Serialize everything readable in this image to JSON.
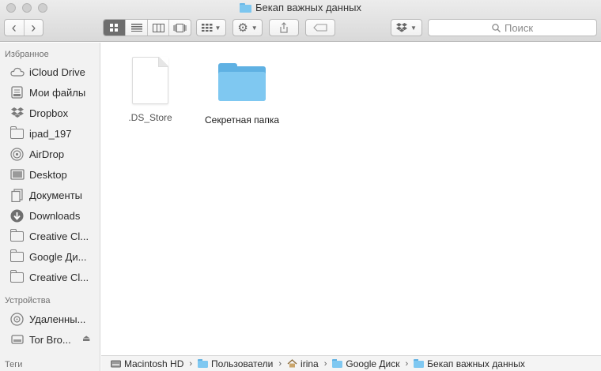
{
  "window": {
    "title": "Бекап важных данных"
  },
  "toolbar": {
    "back_glyph": "‹",
    "forward_glyph": "›",
    "view_modes": [
      "icon-view",
      "list-view",
      "column-view",
      "cover-flow-view"
    ],
    "arrange_icon": "grid-icon",
    "action_icon": "gear-icon",
    "share_icon": "share-icon",
    "tag_icon": "tag-icon",
    "dropbox_icon": "dropbox-icon",
    "search_placeholder": "Поиск"
  },
  "sidebar": {
    "sections": [
      {
        "heading": "Избранное"
      },
      {
        "heading": "Устройства"
      },
      {
        "heading": "Теги"
      }
    ],
    "favorites": [
      {
        "label": "iCloud Drive",
        "icon": "cloud-icon"
      },
      {
        "label": "Мои файлы",
        "icon": "all-files-icon"
      },
      {
        "label": "Dropbox",
        "icon": "dropbox-icon"
      },
      {
        "label": "ipad_197",
        "icon": "folder-icon"
      },
      {
        "label": "AirDrop",
        "icon": "airdrop-icon"
      },
      {
        "label": "Desktop",
        "icon": "desktop-icon"
      },
      {
        "label": "Документы",
        "icon": "documents-icon"
      },
      {
        "label": "Downloads",
        "icon": "downloads-icon"
      },
      {
        "label": "Creative Cl...",
        "icon": "folder-icon"
      },
      {
        "label": "Google Ди...",
        "icon": "folder-icon"
      },
      {
        "label": "Creative Cl...",
        "icon": "folder-icon"
      }
    ],
    "devices": [
      {
        "label": "Удаленны...",
        "icon": "remote-disc-icon"
      },
      {
        "label": "Tor Bro...",
        "icon": "disk-icon",
        "eject": "⏏"
      }
    ]
  },
  "files": [
    {
      "name": ".DS_Store",
      "kind": "document"
    },
    {
      "name": "Секретная папка",
      "kind": "folder"
    }
  ],
  "pathbar": {
    "crumbs": [
      {
        "label": "Macintosh HD",
        "icon": "hard-drive-icon"
      },
      {
        "label": "Пользователи",
        "icon": "folder-icon"
      },
      {
        "label": "irina",
        "icon": "home-icon"
      },
      {
        "label": "Google Диск",
        "icon": "folder-icon"
      },
      {
        "label": "Бекап важных данных",
        "icon": "folder-icon"
      }
    ],
    "separator": "›"
  },
  "colors": {
    "folder": "#7fc8f1",
    "folder_dark": "#5fb1e3",
    "active_segment": "#6e6e6e"
  }
}
